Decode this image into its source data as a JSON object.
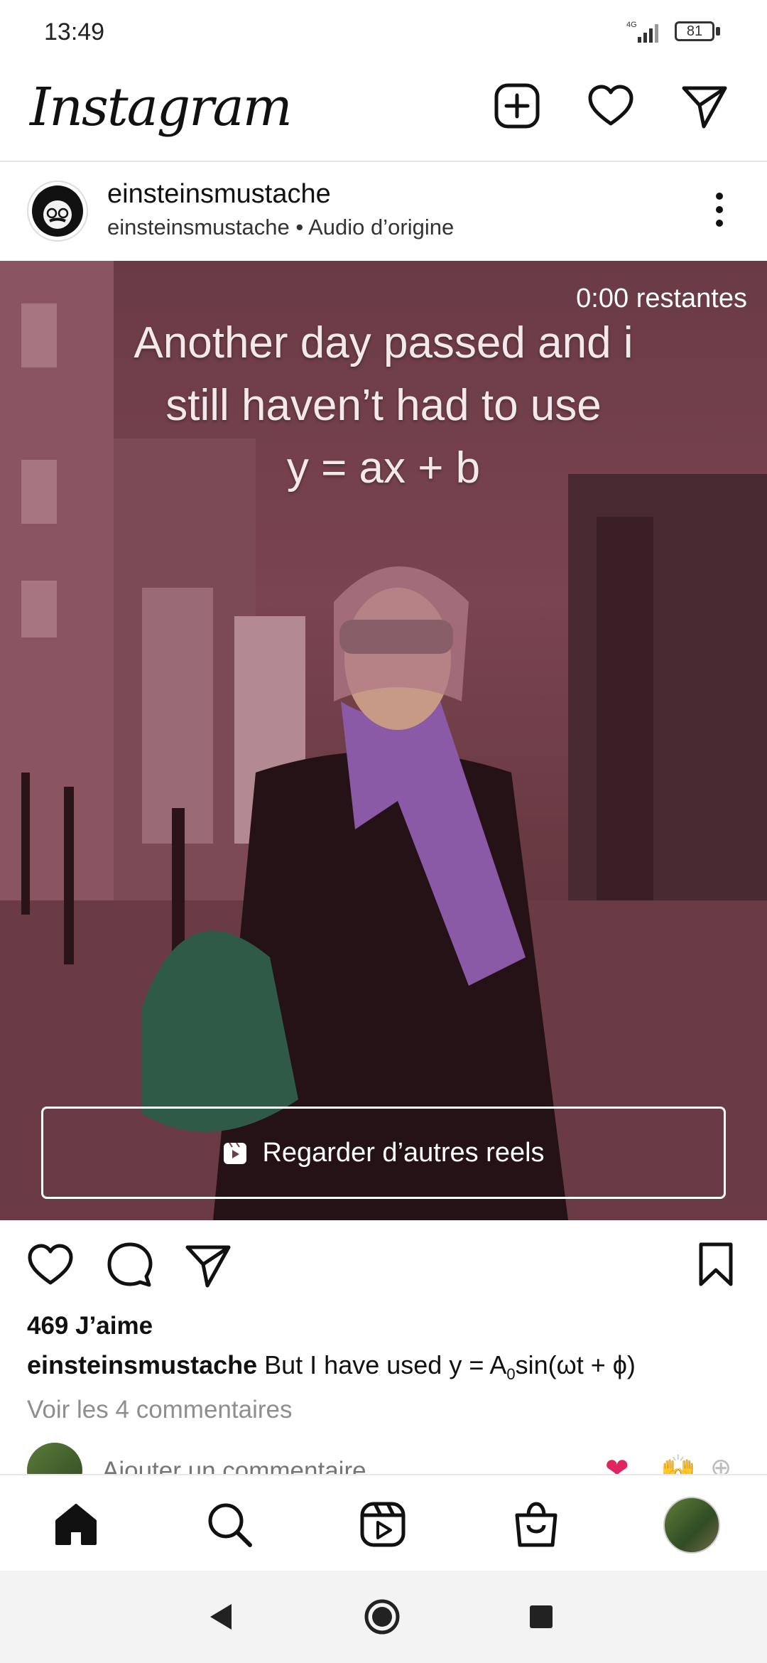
{
  "status_bar": {
    "time": "13:49",
    "network": "4G",
    "battery": "81"
  },
  "app_bar": {
    "title": "Instagram",
    "icons": [
      "plus-square-icon",
      "heart-icon",
      "paper-plane-icon"
    ]
  },
  "post": {
    "username": "einsteinsmustache",
    "subtitle": "einsteinsmustache • Audio d’origine",
    "video": {
      "remaining_time": "0:00 restantes",
      "caption_lines": [
        "Another day passed and i",
        "still haven’t had to use",
        "y = ax + b"
      ],
      "more_reels_label": "Regarder d’autres reels"
    },
    "likes": "469 J’aime",
    "caption_user": "einsteinsmustache",
    "caption_text_prefix": "But I have used y = A",
    "caption_subscript": "0",
    "caption_text_suffix": "sin(ωt + ϕ)",
    "view_comments": "Voir les 4 commentaires",
    "add_comment_placeholder": "Ajouter un commentaire",
    "quick_emojis": [
      "❤",
      "🙌",
      "⊕"
    ]
  },
  "bottom_nav": {
    "items": [
      "home-icon",
      "search-icon",
      "reels-icon",
      "shop-icon",
      "profile-avatar"
    ]
  },
  "colors": {
    "video_tint": "#6e3d47",
    "text_primary": "#111111",
    "text_secondary": "#8e8e8e",
    "divider": "#e6e6e6"
  }
}
